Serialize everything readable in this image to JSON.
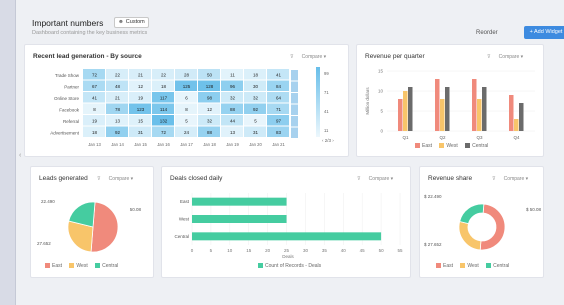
{
  "header": {
    "title": "Important numbers",
    "badge_label": "Custom",
    "subtitle": "Dashboard containing the key business metrics",
    "reorder_label": "Reorder",
    "add_widget_label": "+ Add Widget"
  },
  "compare_label": "Compare",
  "colors": {
    "east": "#f08a7c",
    "west": "#f8c56a",
    "central": "#45cca0",
    "accent": "#3d8be0",
    "gray": "#6b6b6b"
  },
  "legend": {
    "east": "East",
    "west": "West",
    "central": "Central"
  },
  "chart_data": [
    {
      "type": "heatmap",
      "title": "Recent lead generation - By source",
      "rows": [
        "Trade Show",
        "Partner",
        "Online Store",
        "Facebook",
        "Referral",
        "Advertisement"
      ],
      "columns": [
        "Jan 13",
        "Jan 14",
        "Jan 15",
        "Jan 16",
        "Jan 17",
        "Jan 18",
        "Jan 19",
        "Jan 20",
        "Jan 21",
        "Jan 22"
      ],
      "values": [
        [
          72,
          22,
          21,
          22,
          28,
          50,
          11,
          18,
          41,
          null
        ],
        [
          67,
          48,
          12,
          18,
          125,
          128,
          96,
          30,
          84,
          null
        ],
        [
          41,
          21,
          19,
          117,
          6,
          98,
          32,
          32,
          64,
          null
        ],
        [
          8,
          78,
          123,
          114,
          8,
          12,
          88,
          92,
          71,
          null
        ],
        [
          19,
          13,
          15,
          132,
          5,
          32,
          44,
          5,
          97,
          null
        ],
        [
          18,
          92,
          31,
          72,
          24,
          88,
          13,
          31,
          83,
          null
        ]
      ],
      "scale_ticks": [
        "99",
        "71",
        "41",
        "11"
      ],
      "pagination": "2/3"
    },
    {
      "type": "bar",
      "title": "Revenue per quarter",
      "categories": [
        "Q1",
        "Q2",
        "Q3",
        "Q4"
      ],
      "series": [
        {
          "name": "East",
          "values": [
            8,
            13,
            13,
            9
          ]
        },
        {
          "name": "West",
          "values": [
            10,
            8,
            8,
            3
          ]
        },
        {
          "name": "Central",
          "values": [
            11,
            11,
            11,
            7
          ]
        }
      ],
      "ylabel": "Million dollars",
      "ylim": [
        0,
        15
      ],
      "yticks": [
        0,
        5,
        10,
        15
      ]
    },
    {
      "type": "pie",
      "title": "Leads generated",
      "slices": [
        {
          "name": "East",
          "value": 50.08,
          "label": "50.08"
        },
        {
          "name": "West",
          "value": 27.652,
          "label": "27.652"
        },
        {
          "name": "Central",
          "value": 22.49,
          "label": "22.490"
        }
      ]
    },
    {
      "type": "bar",
      "orientation": "horizontal",
      "title": "Deals closed daily",
      "categories": [
        "East",
        "West",
        "Central"
      ],
      "values": [
        25,
        25,
        50
      ],
      "xlabel": "Deals",
      "xticks": [
        0,
        5,
        10,
        15,
        20,
        25,
        30,
        35,
        40,
        45,
        50,
        55
      ],
      "legend": "Count of Records - Deals"
    },
    {
      "type": "pie",
      "donut": true,
      "title": "Revenue share",
      "slices": [
        {
          "name": "East",
          "value": 50.08,
          "label": "$ 50.08"
        },
        {
          "name": "West",
          "value": 27.652,
          "label": "$ 27.652"
        },
        {
          "name": "Central",
          "value": 22.49,
          "label": "$ 22.490"
        }
      ]
    }
  ]
}
